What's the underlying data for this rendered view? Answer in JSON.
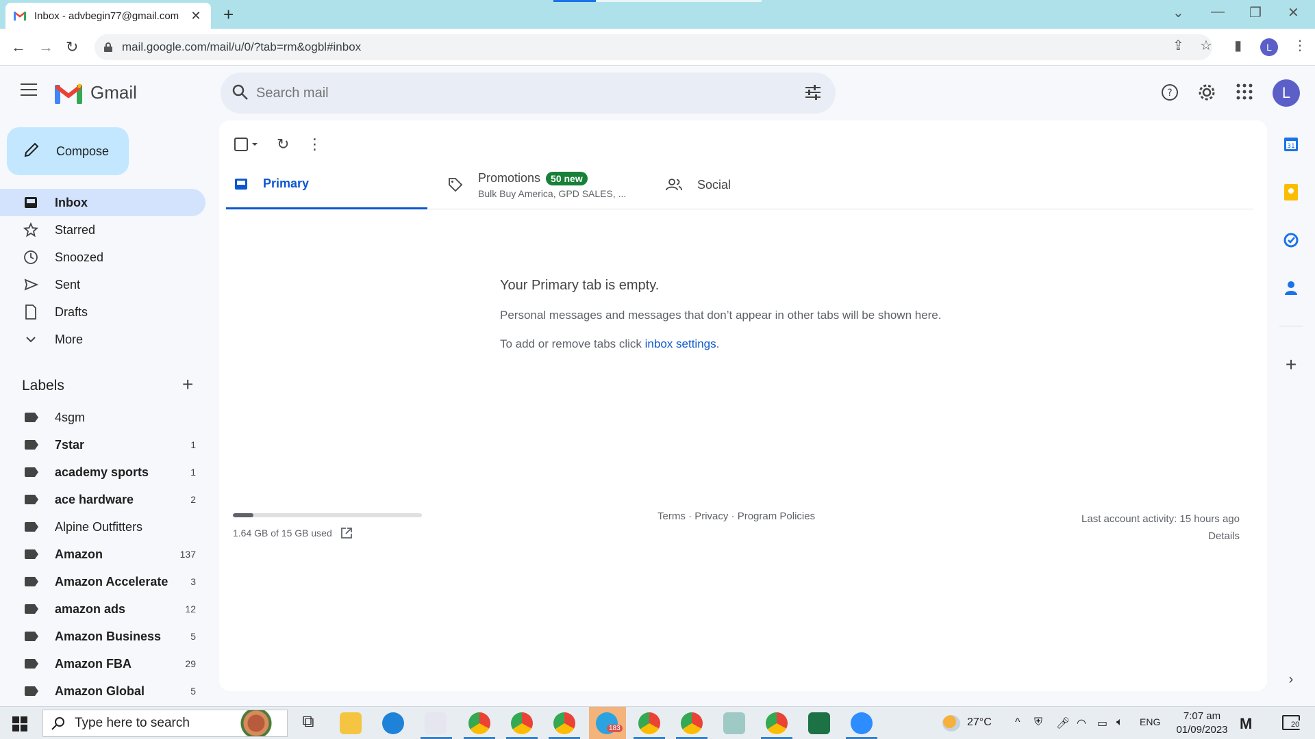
{
  "browser": {
    "tab_title": "Inbox - advbegin77@gmail.com",
    "url": "mail.google.com/mail/u/0/?tab=rm&ogbl#inbox",
    "profile_initial": "L"
  },
  "gmail": {
    "logo_text": "Gmail",
    "search_placeholder": "Search mail",
    "avatar_initial": "L",
    "compose_label": "Compose"
  },
  "nav": {
    "items": [
      {
        "label": "Inbox",
        "icon": "inbox-icon",
        "active": true
      },
      {
        "label": "Starred",
        "icon": "star-icon"
      },
      {
        "label": "Snoozed",
        "icon": "clock-icon"
      },
      {
        "label": "Sent",
        "icon": "send-icon"
      },
      {
        "label": "Drafts",
        "icon": "draft-icon"
      },
      {
        "label": "More",
        "icon": "chevron-down-icon"
      }
    ]
  },
  "labels": {
    "heading": "Labels",
    "items": [
      {
        "name": "4sgm",
        "count": "",
        "bold": false
      },
      {
        "name": "7star",
        "count": "1",
        "bold": true
      },
      {
        "name": "academy sports",
        "count": "1",
        "bold": true
      },
      {
        "name": "ace hardware",
        "count": "2",
        "bold": true
      },
      {
        "name": "Alpine Outfitters",
        "count": "",
        "bold": false
      },
      {
        "name": "Amazon",
        "count": "137",
        "bold": true
      },
      {
        "name": "Amazon Accelerate",
        "count": "3",
        "bold": true
      },
      {
        "name": "amazon ads",
        "count": "12",
        "bold": true
      },
      {
        "name": "Amazon Business",
        "count": "5",
        "bold": true
      },
      {
        "name": "Amazon FBA",
        "count": "29",
        "bold": true
      },
      {
        "name": "Amazon Global",
        "count": "5",
        "bold": true
      }
    ]
  },
  "inbox_tabs": {
    "primary": "Primary",
    "promotions": "Promotions",
    "promotions_badge": "50 new",
    "promotions_sub": "Bulk Buy America, GPD SALES, ...",
    "social": "Social"
  },
  "empty_state": {
    "heading": "Your Primary tab is empty.",
    "line1": "Personal messages and messages that don’t appear in other tabs will be shown here.",
    "line2_prefix": "To add or remove tabs click ",
    "line2_link": "inbox settings",
    "line2_suffix": "."
  },
  "footer": {
    "storage_text": "1.64 GB of 15 GB used",
    "storage_fraction": 0.109,
    "terms": "Terms",
    "privacy": "Privacy",
    "policies": "Program Policies",
    "sep": " · ",
    "last_activity": "Last account activity: 15 hours ago",
    "details": "Details"
  },
  "taskbar": {
    "search_placeholder": "Type here to search",
    "weather": "27°C",
    "language": "ENG",
    "time": "7:07 am",
    "date": "01/09/2023",
    "telegram_badge": "183",
    "notifications": "20"
  }
}
